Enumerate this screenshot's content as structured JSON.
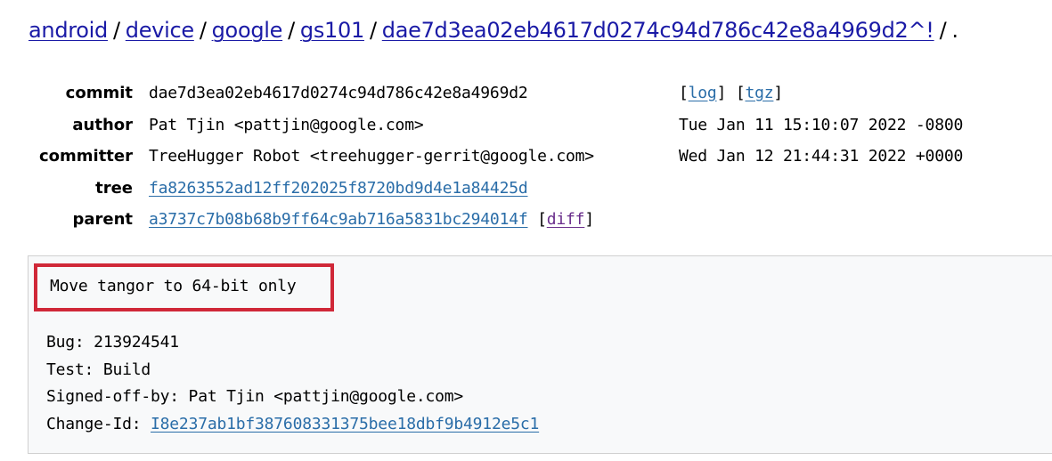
{
  "breadcrumb": {
    "items": [
      {
        "label": "android"
      },
      {
        "label": "device"
      },
      {
        "label": "google"
      },
      {
        "label": "gs101"
      },
      {
        "label": "dae7d3ea02eb4617d0274c94d786c42e8a4969d2^!"
      }
    ],
    "separator": "/",
    "trailing": "."
  },
  "meta": {
    "commit": {
      "label": "commit",
      "value": "dae7d3ea02eb4617d0274c94d786c42e8a4969d2",
      "log_link": "log",
      "tgz_link": "tgz"
    },
    "author": {
      "label": "author",
      "value": "Pat Tjin <pattjin@google.com>",
      "date": "Tue Jan 11 15:10:07 2022 -0800"
    },
    "committer": {
      "label": "committer",
      "value": "TreeHugger Robot <treehugger-gerrit@google.com>",
      "date": "Wed Jan 12 21:44:31 2022 +0000"
    },
    "tree": {
      "label": "tree",
      "value": "fa8263552ad12ff202025f8720bd9d4e1a84425d"
    },
    "parent": {
      "label": "parent",
      "value": "a3737c7b08b68b9ff64c9ab716a5831bc294014f",
      "diff_link": "diff"
    }
  },
  "message": {
    "subject": "Move tangor to 64-bit only",
    "bug": "Bug: 213924541",
    "test": "Test: Build",
    "signed_off": "Signed-off-by: Pat Tjin <pattjin@google.com>",
    "change_id_label": "Change-Id: ",
    "change_id": "I8e237ab1bf387608331375bee18dbf9b4912e5c1"
  },
  "colors": {
    "link": "#1a1aa6",
    "hash_link": "#2a6da8",
    "visited_link": "#6a2f8c",
    "highlight_border": "#d02838",
    "message_bg": "#f8f9fa"
  }
}
